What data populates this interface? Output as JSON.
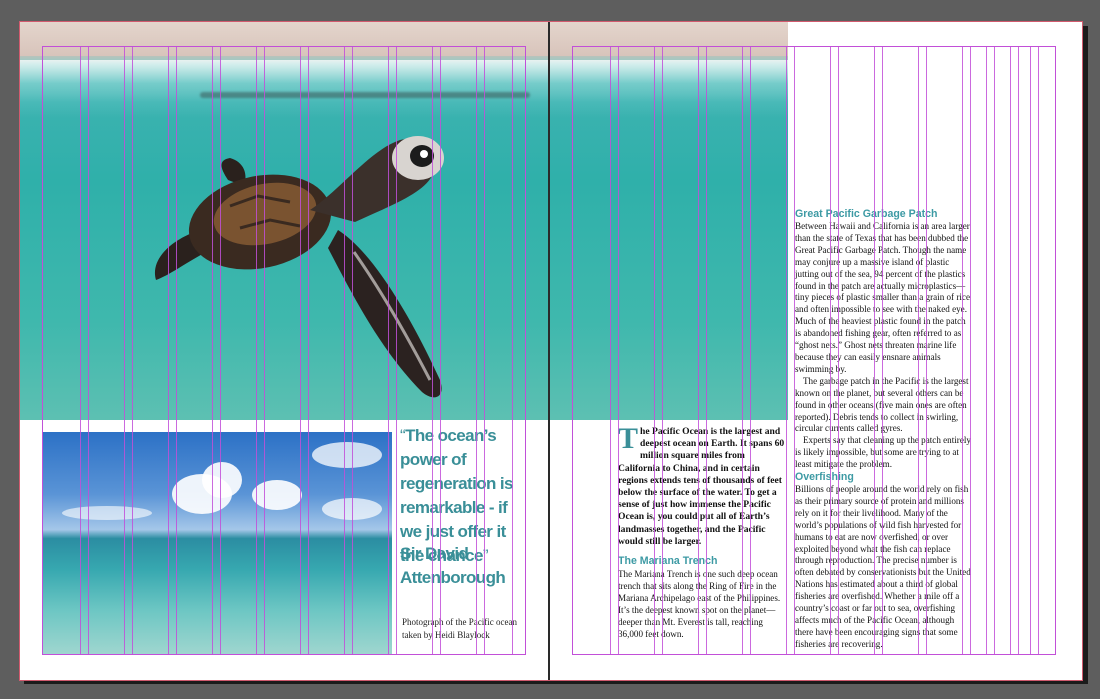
{
  "colors": {
    "accent_teal": "#3a8f98",
    "grid_guides": "#c24fd8",
    "page_border": "#d15a6e",
    "pasteboard": "#5e5e5e"
  },
  "images": {
    "turtle_photo": "sea-turtle-photo",
    "ocean_photo": "pacific-ocean-photo"
  },
  "pull_quote": {
    "open_mark": "“",
    "text": "The ocean’s power of regeneration is remarkable - if we just offer it the chance",
    "close_mark": "”",
    "attribution": "Sir David Attenborough"
  },
  "caption": "Photograph of the Pacific ocean taken by Heidi Blaylock",
  "lead": {
    "drop_cap": "T",
    "text": "he Pacific Ocean is the largest and deepest ocean on Earth. It spans 60 million square miles from California to China, and in certain regions extends tens of thousands of feet below the surface of the water. To get a sense of just how immense the Pacific Ocean is, you could put all of Earth’s landmasses together, and the Pacific would still be larger."
  },
  "mariana": {
    "heading": "The Mariana Trench",
    "body": "The Mariana Trench is one such deep ocean trench that sits along the Ring of Fire in the Mariana Archipelago east of the Philippines. It’s the deepest known spot on the planet—deeper than Mt. Everest is tall, reaching 36,000 feet down."
  },
  "garbage": {
    "heading": "Great Pacific Garbage Patch",
    "p1": "Between Hawaii and California is an area larger than the state of Texas that has been dubbed the Great Pacific Garbage Patch. Though the name may conjure up a massive island of plastic jutting out of the sea, 94 percent of the plastics found in the patch are actually microplastics—tiny pieces of plastic smaller than a grain of rice and often impossible to see with the naked eye. Much of the heaviest plastic found in the patch is abandoned fishing gear, often referred to as “ghost nets.” Ghost nets threaten marine life because they can easily ensnare animals swimming by.",
    "p2": "The garbage patch in the Pacific is the largest known on the planet, but several others can be found in other oceans (five main ones are often reported). Debris tends to collect in swirling, circular currents called gyres.",
    "p3": "Experts say that cleaning up the patch entirely is likely impossible, but some are trying to at least mitigate the problem."
  },
  "overfishing": {
    "heading": "Overfishing",
    "body": "Billions of people around the world rely on fish as their primary source of protein and millions rely on it for their livelihood. Many of the world’s populations of wild fish harvested for humans to eat are now overfished, or over exploited beyond what the fish can replace through reproduction. The precise number is often debated by conservationists but the United Nations has estimated about a third of global fisheries are overfished. Whether a mile off a country’s coast or far out to sea, overfishing affects much of the Pacific Ocean, although there have been encouraging signs that some fisheries are recovering."
  }
}
